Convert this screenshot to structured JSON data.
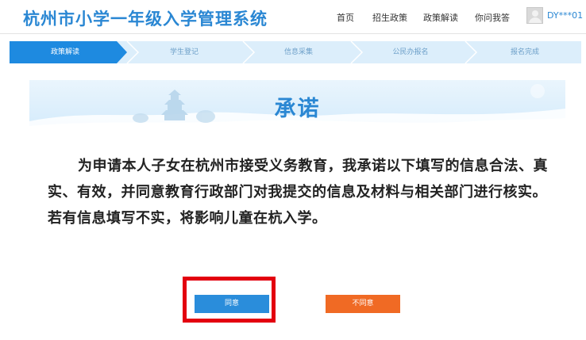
{
  "header": {
    "title": "杭州市小学一年级入学管理系统",
    "nav": [
      "首页",
      "招生政策",
      "政策解读",
      "你问我答"
    ],
    "user": "DY***01"
  },
  "steps": {
    "items": [
      "政策解读",
      "学生登记",
      "信息采集",
      "公民办报名",
      "报名完成"
    ],
    "active_index": 0
  },
  "banner": {
    "title": "承诺"
  },
  "pledge": {
    "text": "为申请本人子女在杭州市接受义务教育，我承诺以下填写的信息合法、真实、有效，并同意教育行政部门对我提交的信息及材料与相关部门进行核实。若有信息填写不实，将影响儿童在杭入学。"
  },
  "actions": {
    "agree": "同意",
    "disagree": "不同意"
  },
  "colors": {
    "primary": "#2a87d3",
    "step_active": "#1e8ae0",
    "step_inactive": "#dceefb",
    "agree": "#2a8ddb",
    "disagree": "#f06a24",
    "highlight": "#e3000f"
  }
}
